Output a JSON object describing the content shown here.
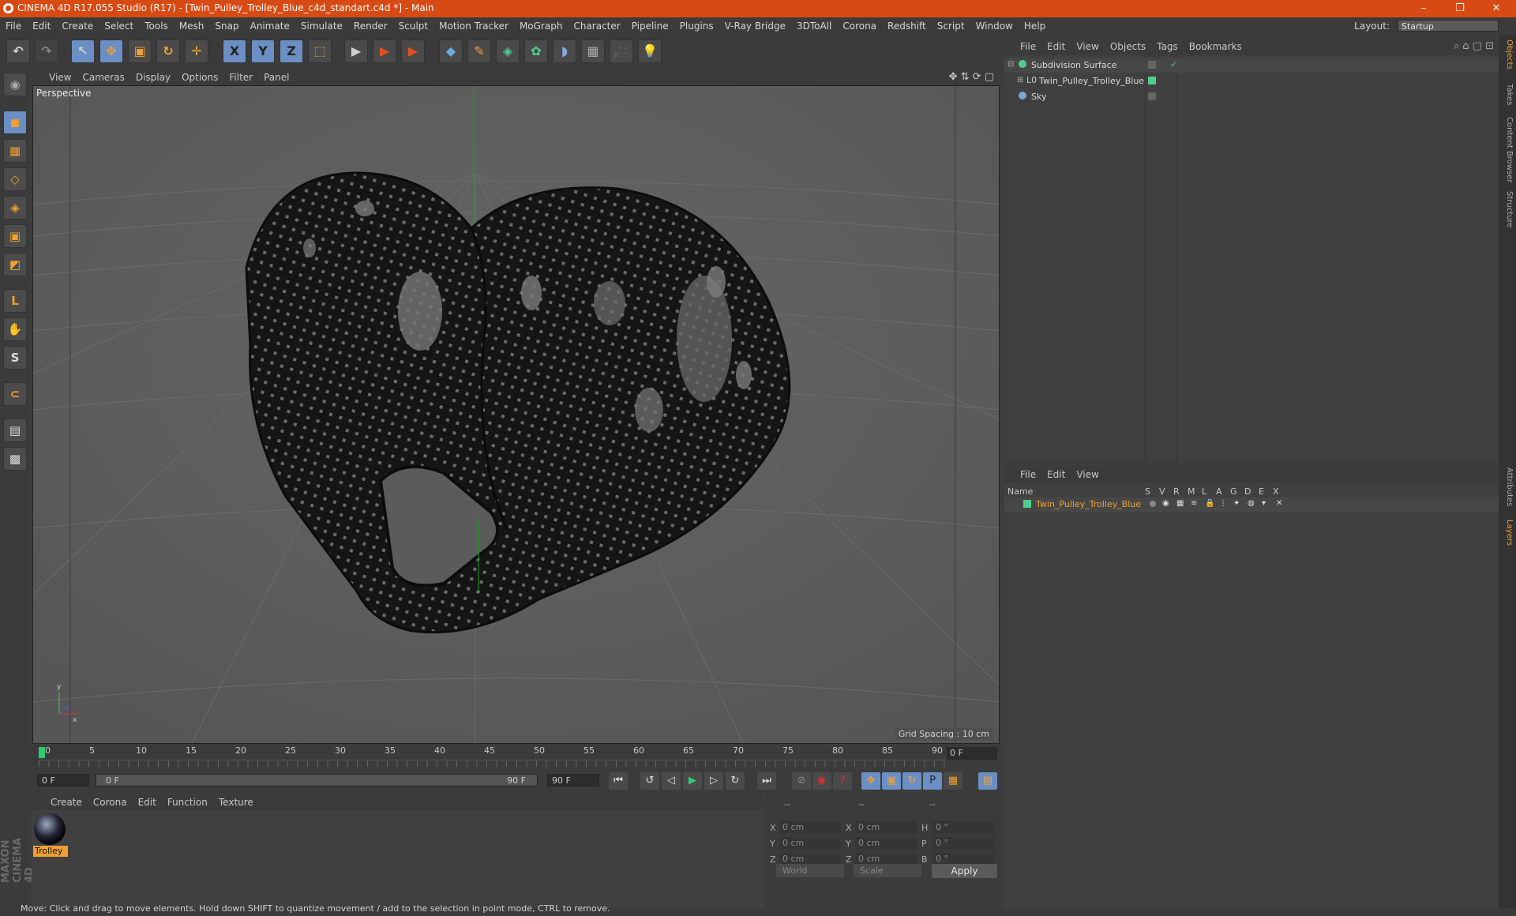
{
  "window": {
    "title": "CINEMA 4D R17.055 Studio (R17) - [Twin_Pulley_Trolley_Blue_c4d_standart.c4d *] - Main",
    "minimize": "–",
    "restore": "❐",
    "close": "✕"
  },
  "menu": [
    "File",
    "Edit",
    "Create",
    "Select",
    "Tools",
    "Mesh",
    "Snap",
    "Animate",
    "Simulate",
    "Render",
    "Sculpt",
    "Motion Tracker",
    "MoGraph",
    "Character",
    "Pipeline",
    "Plugins",
    "V-Ray Bridge",
    "3DToAll",
    "Corona",
    "Redshift",
    "Script",
    "Window",
    "Help"
  ],
  "layout": {
    "label": "Layout:",
    "value": "Startup"
  },
  "toolbar_glyphs": {
    "undo": "↶",
    "redo": "↷",
    "select": "↖",
    "move": "✥",
    "scale": "▣",
    "rotate": "↻",
    "move2": "✛",
    "x": "X",
    "y": "Y",
    "z": "Z",
    "coord": "⬚",
    "render1": "▶",
    "render2": "▶",
    "render3": "▶",
    "cube": "◆",
    "pen": "✎",
    "subdiv": "◈",
    "clone": "✿",
    "deform": "◗",
    "floor": "▦",
    "camera": "🎥",
    "light": "💡"
  },
  "left_glyphs": [
    "◉",
    "◼",
    "▦",
    "◇",
    "◈",
    "▣",
    "◩",
    "L",
    "✋",
    "S",
    "⊂",
    "▤",
    "▩"
  ],
  "viewport": {
    "menu": [
      "View",
      "Cameras",
      "Display",
      "Options",
      "Filter",
      "Panel"
    ],
    "label": "Perspective",
    "grid_spacing": "Grid Spacing : 10 cm",
    "axis_y": "y",
    "axis_x": "x"
  },
  "timeline": {
    "ticks": [
      "0",
      "5",
      "10",
      "15",
      "20",
      "25",
      "30",
      "35",
      "40",
      "45",
      "50",
      "55",
      "60",
      "65",
      "70",
      "75",
      "80",
      "85",
      "90"
    ],
    "current_frame": "0 F",
    "start_field": "0 F",
    "range_start": "0 F",
    "range_end": "90 F",
    "end_field": "90 F"
  },
  "transport": {
    "first": "⏮",
    "loop": "↺",
    "prev": "◁",
    "play": "▶",
    "next": "▷",
    "loop2": "↻",
    "last": "⏭"
  },
  "material_menu": [
    "Create",
    "Corona",
    "Edit",
    "Function",
    "Texture"
  ],
  "material": {
    "name": "Trolley"
  },
  "coords": {
    "header": [
      "--",
      "--",
      "--"
    ],
    "rows": [
      {
        "l1": "X",
        "v1": "0 cm",
        "l2": "X",
        "v2": "0 cm",
        "l3": "H",
        "v3": "0 °"
      },
      {
        "l1": "Y",
        "v1": "0 cm",
        "l2": "Y",
        "v2": "0 cm",
        "l3": "P",
        "v3": "0 °"
      },
      {
        "l1": "Z",
        "v1": "0 cm",
        "l2": "Z",
        "v2": "0 cm",
        "l3": "B",
        "v3": "0 °"
      }
    ],
    "space": "World",
    "mode": "Scale",
    "apply": "Apply"
  },
  "objects": {
    "menu": [
      "File",
      "Edit",
      "View",
      "Objects",
      "Tags",
      "Bookmarks"
    ],
    "items": [
      "Subdivision Surface",
      "Twin_Pulley_Trolley_Blue",
      "Sky"
    ]
  },
  "layers": {
    "menu": [
      "File",
      "Edit",
      "View"
    ],
    "columns": [
      "Name",
      "S",
      "V",
      "R",
      "M",
      "L",
      "A",
      "G",
      "D",
      "E",
      "X"
    ],
    "items": [
      "Twin_Pulley_Trolley_Blue"
    ]
  },
  "right_tabs": [
    "Objects",
    "Takes",
    "Content Browser",
    "Structure",
    "Attributes",
    "Layers"
  ],
  "status": "Move: Click and drag to move elements. Hold down SHIFT to quantize movement / add to the selection in point mode, CTRL to remove.",
  "brand": "MAXON CINEMA 4D",
  "colors": {
    "titlebar": "#d84a14",
    "accent": "#f0a030",
    "active_tool": "#6b8fc4"
  }
}
